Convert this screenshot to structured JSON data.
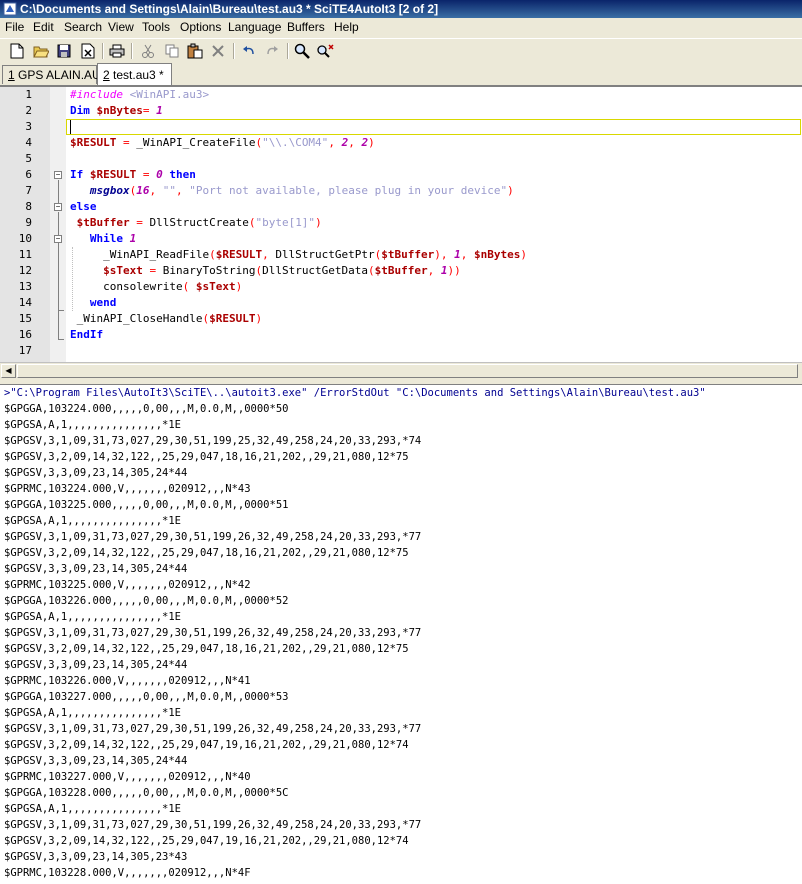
{
  "window": {
    "title": "C:\\Documents and Settings\\Alain\\Bureau\\test.au3 * SciTE4AutoIt3 [2 of 2]"
  },
  "menu": [
    "File",
    "Edit",
    "Search",
    "View",
    "Tools",
    "Options",
    "Language",
    "Buffers",
    "Help"
  ],
  "toolbar": {
    "icons": [
      "new-icon",
      "open-icon",
      "save-icon",
      "close-file-icon",
      "print-icon",
      "cut-icon",
      "copy-icon",
      "paste-icon",
      "delete-icon",
      "undo-icon",
      "redo-icon",
      "find-icon",
      "replace-icon"
    ]
  },
  "tabs": [
    {
      "num": "1",
      "label": " GPS ALAIN.AU3"
    },
    {
      "num": "2",
      "label": " test.au3 *"
    }
  ],
  "editor": {
    "line_numbers": [
      "1",
      "2",
      "3",
      "4",
      "5",
      "6",
      "7",
      "8",
      "9",
      "10",
      "11",
      "12",
      "13",
      "14",
      "15",
      "16",
      "17"
    ],
    "lines": [
      [
        {
          "t": "pre",
          "v": "#include "
        },
        {
          "t": "str",
          "v": "<WinAPI.au3>"
        }
      ],
      [
        {
          "t": "kw",
          "v": "Dim "
        },
        {
          "t": "var",
          "v": "$nBytes"
        },
        {
          "t": "op",
          "v": "= "
        },
        {
          "t": "num",
          "v": "1"
        }
      ],
      [],
      [
        {
          "t": "var",
          "v": "$RESULT "
        },
        {
          "t": "op",
          "v": "= "
        },
        {
          "t": "plain",
          "v": "_WinAPI_CreateFile"
        },
        {
          "t": "op",
          "v": "("
        },
        {
          "t": "str",
          "v": "\"\\\\.\\COM4\""
        },
        {
          "t": "op",
          "v": ", "
        },
        {
          "t": "num",
          "v": "2"
        },
        {
          "t": "op",
          "v": ", "
        },
        {
          "t": "num",
          "v": "2"
        },
        {
          "t": "op",
          "v": ")"
        }
      ],
      [],
      [
        {
          "t": "kw",
          "v": "If "
        },
        {
          "t": "var",
          "v": "$RESULT "
        },
        {
          "t": "op",
          "v": "= "
        },
        {
          "t": "num",
          "v": "0 "
        },
        {
          "t": "kw",
          "v": "then"
        }
      ],
      [
        {
          "t": "plain",
          "v": "   "
        },
        {
          "t": "fn",
          "v": "msgbox"
        },
        {
          "t": "op",
          "v": "("
        },
        {
          "t": "num",
          "v": "16"
        },
        {
          "t": "op",
          "v": ", "
        },
        {
          "t": "str",
          "v": "\"\""
        },
        {
          "t": "op",
          "v": ", "
        },
        {
          "t": "str",
          "v": "\"Port not available, please plug in your device\""
        },
        {
          "t": "op",
          "v": ")"
        }
      ],
      [
        {
          "t": "kw",
          "v": "else"
        }
      ],
      [
        {
          "t": "plain",
          "v": " "
        },
        {
          "t": "var",
          "v": "$tBuffer "
        },
        {
          "t": "op",
          "v": "= "
        },
        {
          "t": "plain",
          "v": "DllStructCreate"
        },
        {
          "t": "op",
          "v": "("
        },
        {
          "t": "str",
          "v": "\"byte[1]\""
        },
        {
          "t": "op",
          "v": ")"
        }
      ],
      [
        {
          "t": "plain",
          "v": "   "
        },
        {
          "t": "kw",
          "v": "While "
        },
        {
          "t": "num",
          "v": "1"
        }
      ],
      [
        {
          "t": "plain",
          "v": "     _WinAPI_ReadFile"
        },
        {
          "t": "op",
          "v": "("
        },
        {
          "t": "var",
          "v": "$RESULT"
        },
        {
          "t": "op",
          "v": ", "
        },
        {
          "t": "plain",
          "v": "DllStructGetPtr"
        },
        {
          "t": "op",
          "v": "("
        },
        {
          "t": "var",
          "v": "$tBuffer"
        },
        {
          "t": "op",
          "v": "), "
        },
        {
          "t": "num",
          "v": "1"
        },
        {
          "t": "op",
          "v": ", "
        },
        {
          "t": "var",
          "v": "$nBytes"
        },
        {
          "t": "op",
          "v": ")"
        }
      ],
      [
        {
          "t": "plain",
          "v": "     "
        },
        {
          "t": "var",
          "v": "$sText "
        },
        {
          "t": "op",
          "v": "= "
        },
        {
          "t": "plain",
          "v": "BinaryToString"
        },
        {
          "t": "op",
          "v": "("
        },
        {
          "t": "plain",
          "v": "DllStructGetData"
        },
        {
          "t": "op",
          "v": "("
        },
        {
          "t": "var",
          "v": "$tBuffer"
        },
        {
          "t": "op",
          "v": ", "
        },
        {
          "t": "num",
          "v": "1"
        },
        {
          "t": "op",
          "v": "))"
        }
      ],
      [
        {
          "t": "plain",
          "v": "     consolewrite"
        },
        {
          "t": "op",
          "v": "( "
        },
        {
          "t": "var",
          "v": "$sText"
        },
        {
          "t": "op",
          "v": ")"
        }
      ],
      [
        {
          "t": "plain",
          "v": "   "
        },
        {
          "t": "kw",
          "v": "wend"
        }
      ],
      [
        {
          "t": "plain",
          "v": " _WinAPI_CloseHandle"
        },
        {
          "t": "op",
          "v": "("
        },
        {
          "t": "var",
          "v": "$RESULT"
        },
        {
          "t": "op",
          "v": ")"
        }
      ],
      [
        {
          "t": "kw",
          "v": "EndIf"
        }
      ],
      []
    ]
  },
  "output": {
    "command": ">\"C:\\Program Files\\AutoIt3\\SciTE\\..\\autoit3.exe\" /ErrorStdOut \"C:\\Documents and Settings\\Alain\\Bureau\\test.au3\"",
    "lines": [
      "$GPGGA,103224.000,,,,,0,00,,,M,0.0,M,,0000*50",
      "$GPGSA,A,1,,,,,,,,,,,,,,,*1E",
      "$GPGSV,3,1,09,31,73,027,29,30,51,199,25,32,49,258,24,20,33,293,*74",
      "$GPGSV,3,2,09,14,32,122,,25,29,047,18,16,21,202,,29,21,080,12*75",
      "$GPGSV,3,3,09,23,14,305,24*44",
      "$GPRMC,103224.000,V,,,,,,,020912,,,N*43",
      "$GPGGA,103225.000,,,,,0,00,,,M,0.0,M,,0000*51",
      "$GPGSA,A,1,,,,,,,,,,,,,,,*1E",
      "$GPGSV,3,1,09,31,73,027,29,30,51,199,26,32,49,258,24,20,33,293,*77",
      "$GPGSV,3,2,09,14,32,122,,25,29,047,18,16,21,202,,29,21,080,12*75",
      "$GPGSV,3,3,09,23,14,305,24*44",
      "$GPRMC,103225.000,V,,,,,,,020912,,,N*42",
      "$GPGGA,103226.000,,,,,0,00,,,M,0.0,M,,0000*52",
      "$GPGSA,A,1,,,,,,,,,,,,,,,*1E",
      "$GPGSV,3,1,09,31,73,027,29,30,51,199,26,32,49,258,24,20,33,293,*77",
      "$GPGSV,3,2,09,14,32,122,,25,29,047,18,16,21,202,,29,21,080,12*75",
      "$GPGSV,3,3,09,23,14,305,24*44",
      "$GPRMC,103226.000,V,,,,,,,020912,,,N*41",
      "$GPGGA,103227.000,,,,,0,00,,,M,0.0,M,,0000*53",
      "$GPGSA,A,1,,,,,,,,,,,,,,,*1E",
      "$GPGSV,3,1,09,31,73,027,29,30,51,199,26,32,49,258,24,20,33,293,*77",
      "$GPGSV,3,2,09,14,32,122,,25,29,047,19,16,21,202,,29,21,080,12*74",
      "$GPGSV,3,3,09,23,14,305,24*44",
      "$GPRMC,103227.000,V,,,,,,,020912,,,N*40",
      "$GPGGA,103228.000,,,,,0,00,,,M,0.0,M,,0000*5C",
      "$GPGSA,A,1,,,,,,,,,,,,,,,*1E",
      "$GPGSV,3,1,09,31,73,027,29,30,51,199,26,32,49,258,24,20,33,293,*77",
      "$GPGSV,3,2,09,14,32,122,,25,29,047,19,16,21,202,,29,21,080,12*74",
      "$GPGSV,3,3,09,23,14,305,23*43",
      "$GPRMC,103228.000,V,,,,,,,020912,,,N*4F"
    ]
  }
}
